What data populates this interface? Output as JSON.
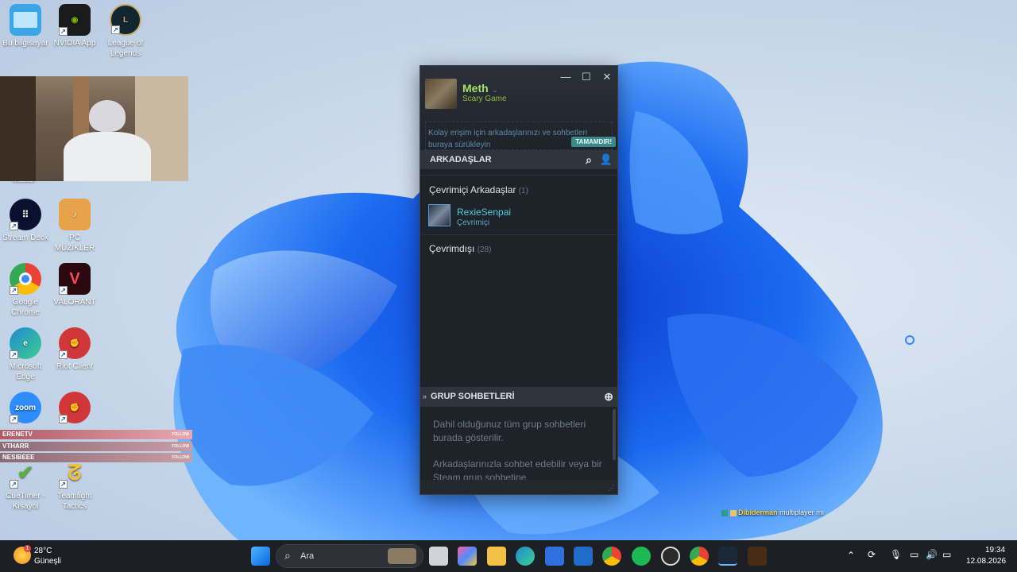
{
  "desktop": {
    "icons": [
      {
        "label": "Bu bilgisayar",
        "icon": "computer-icon",
        "color": "#3aa6e8"
      },
      {
        "label": "NVIDIA App",
        "icon": "nvidia-icon",
        "color": "#76b900"
      },
      {
        "label": "League of Legends",
        "icon": "league-icon",
        "color": "#c8aa6e"
      },
      {
        "label": "Stream Deck",
        "icon": "stream-deck-icon",
        "color": "#0b1030"
      },
      {
        "label": "PC MÜZİKLER",
        "icon": "folder-music-icon",
        "color": "#e8a24a"
      },
      {
        "label": "Google Chrome",
        "icon": "chrome-icon",
        "color": "#4285f4"
      },
      {
        "label": "VALORANT",
        "icon": "valorant-icon",
        "color": "#ff4655"
      },
      {
        "label": "Microsoft Edge",
        "icon": "edge-icon",
        "color": "#1f8ad1"
      },
      {
        "label": "Riot Client",
        "icon": "riot-icon",
        "color": "#d13639"
      },
      {
        "label": "zoom",
        "icon": "zoom-icon",
        "color": "#2d8cff"
      },
      {
        "label": "",
        "icon": "riot-icon",
        "color": "#d13639"
      },
      {
        "label": "CueTimer - Kısayol",
        "icon": "cuetimer-icon",
        "color": "#59b33b"
      },
      {
        "label": "Teamfight Tactics",
        "icon": "tft-icon",
        "color": "#f4c430"
      }
    ],
    "partial_label": "Masası"
  },
  "stream_overlay": {
    "follows": [
      {
        "name": "ERENETV",
        "tag": "FOLLOW"
      },
      {
        "name": "VTHARR",
        "tag": "FOLLOW"
      },
      {
        "name": "NESIBEEE",
        "tag": "FOLLOW"
      }
    ],
    "chat_user": "Dibiderman",
    "chat_msg": "multiplayer mı"
  },
  "steam": {
    "user_name": "Meth",
    "user_game": "Scary Game",
    "drop_hint": "Kolay erişim için arkadaşlarınızı ve sohbetleri buraya sürükleyin",
    "ok_button": "TAMAMDIR!",
    "friends_header": "ARKADAŞLAR",
    "online_group": "Çevrimiçi Arkadaşlar",
    "online_count": "(1)",
    "friend_name": "RexieSenpai",
    "friend_status": "Çevrimiçi",
    "offline_group": "Çevrimdışı",
    "offline_count": "(28)",
    "group_chats_header": "GRUP SOHBETLERİ",
    "group_text_1": "Dahil olduğunuz tüm grup sohbetleri burada gösterilir.",
    "group_text_2": "Arkadaşlarınızla sohbet edebilir veya bir Steam grup sohbetine"
  },
  "taskbar": {
    "weather_temp": "28°C",
    "weather_desc": "Güneşli",
    "weather_badge": "1",
    "search_placeholder": "Ara",
    "time": "19:34",
    "date": "12.08.2026"
  }
}
